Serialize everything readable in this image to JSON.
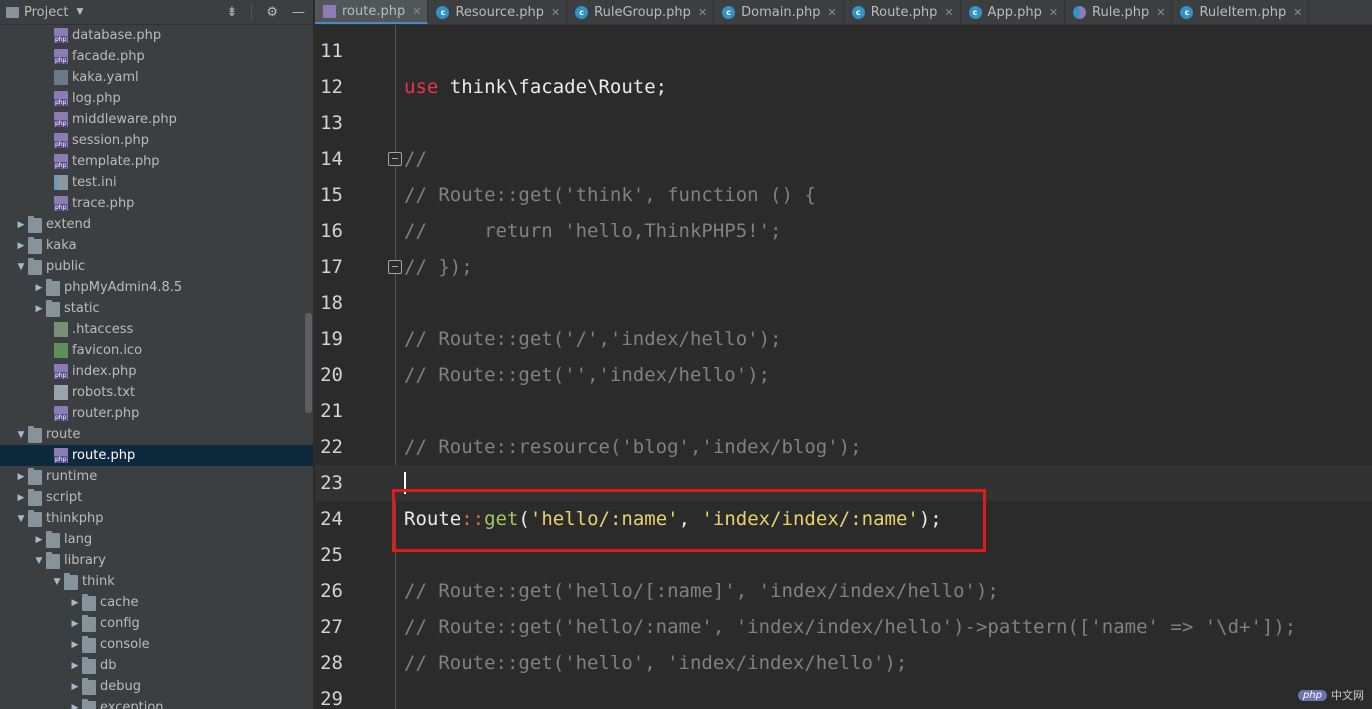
{
  "project_panel": {
    "title": "Project",
    "tree": [
      {
        "label": "database.php",
        "icon": "php-file-icon",
        "level": 3
      },
      {
        "label": "facade.php",
        "icon": "php-file-icon",
        "level": 3
      },
      {
        "label": "kaka.yaml",
        "icon": "yaml-file-icon",
        "level": 3
      },
      {
        "label": "log.php",
        "icon": "php-file-icon",
        "level": 3
      },
      {
        "label": "middleware.php",
        "icon": "php-file-icon",
        "level": 3
      },
      {
        "label": "session.php",
        "icon": "php-file-icon",
        "level": 3
      },
      {
        "label": "template.php",
        "icon": "php-file-icon",
        "level": 3
      },
      {
        "label": "test.ini",
        "icon": "ini-file-icon",
        "level": 3
      },
      {
        "label": "trace.php",
        "icon": "php-file-icon",
        "level": 3
      },
      {
        "label": "extend",
        "icon": "folder-icon",
        "level": 1,
        "expanded": false
      },
      {
        "label": "kaka",
        "icon": "folder-icon",
        "level": 1,
        "expanded": false
      },
      {
        "label": "public",
        "icon": "folder-icon",
        "level": 1,
        "expanded": true
      },
      {
        "label": "phpMyAdmin4.8.5",
        "icon": "folder-icon",
        "level": 2,
        "expanded": false
      },
      {
        "label": "static",
        "icon": "folder-icon",
        "level": 2,
        "expanded": false
      },
      {
        "label": ".htaccess",
        "icon": "htaccess-file-icon",
        "level": 3
      },
      {
        "label": "favicon.ico",
        "icon": "image-file-icon",
        "level": 3
      },
      {
        "label": "index.php",
        "icon": "php-file-icon",
        "level": 3
      },
      {
        "label": "robots.txt",
        "icon": "text-file-icon",
        "level": 3
      },
      {
        "label": "router.php",
        "icon": "php-file-icon",
        "level": 3
      },
      {
        "label": "route",
        "icon": "folder-icon",
        "level": 1,
        "expanded": true
      },
      {
        "label": "route.php",
        "icon": "php-file-icon",
        "level": 3,
        "selected": true
      },
      {
        "label": "runtime",
        "icon": "folder-icon",
        "level": 1,
        "expanded": false
      },
      {
        "label": "script",
        "icon": "folder-icon",
        "level": 1,
        "expanded": false
      },
      {
        "label": "thinkphp",
        "icon": "folder-icon",
        "level": 1,
        "expanded": true
      },
      {
        "label": "lang",
        "icon": "folder-icon",
        "level": 2,
        "expanded": false
      },
      {
        "label": "library",
        "icon": "folder-icon",
        "level": 2,
        "expanded": true
      },
      {
        "label": "think",
        "icon": "folder-icon",
        "level": 3,
        "expanded": true
      },
      {
        "label": "cache",
        "icon": "folder-icon",
        "level": 4,
        "expanded": false
      },
      {
        "label": "config",
        "icon": "folder-icon",
        "level": 4,
        "expanded": false
      },
      {
        "label": "console",
        "icon": "folder-icon",
        "level": 4,
        "expanded": false
      },
      {
        "label": "db",
        "icon": "folder-icon",
        "level": 4,
        "expanded": false
      },
      {
        "label": "debug",
        "icon": "folder-icon",
        "level": 4,
        "expanded": false
      },
      {
        "label": "exception",
        "icon": "folder-icon",
        "level": 4,
        "expanded": false
      }
    ]
  },
  "tabs": [
    {
      "label": "route.php",
      "icon": "php",
      "active": true
    },
    {
      "label": "Resource.php",
      "icon": "class"
    },
    {
      "label": "RuleGroup.php",
      "icon": "class"
    },
    {
      "label": "Domain.php",
      "icon": "class"
    },
    {
      "label": "Route.php",
      "icon": "class"
    },
    {
      "label": "App.php",
      "icon": "class"
    },
    {
      "label": "Rule.php",
      "icon": "half"
    },
    {
      "label": "RuleItem.php",
      "icon": "class"
    }
  ],
  "code": {
    "line_numbers": [
      "11",
      "12",
      "13",
      "14",
      "15",
      "16",
      "17",
      "18",
      "19",
      "20",
      "21",
      "22",
      "23",
      "24",
      "25",
      "26",
      "27",
      "28",
      "29"
    ],
    "current_line": "23",
    "lines": [
      {
        "n": "11",
        "parts": []
      },
      {
        "n": "12",
        "parts": [
          {
            "t": "use",
            "c": "kw-use"
          },
          {
            "t": " think\\facade\\Route;",
            "c": "plain"
          }
        ]
      },
      {
        "n": "13",
        "parts": []
      },
      {
        "n": "14",
        "parts": [
          {
            "t": "//",
            "c": "cmt"
          }
        ],
        "fold": true
      },
      {
        "n": "15",
        "parts": [
          {
            "t": "// Route::get('think', function () {",
            "c": "cmt"
          }
        ]
      },
      {
        "n": "16",
        "parts": [
          {
            "t": "//     return 'hello,ThinkPHP5!';",
            "c": "cmt"
          }
        ]
      },
      {
        "n": "17",
        "parts": [
          {
            "t": "// });",
            "c": "cmt"
          }
        ],
        "fold": true
      },
      {
        "n": "18",
        "parts": []
      },
      {
        "n": "19",
        "parts": [
          {
            "t": "// Route::get('/','index/hello');",
            "c": "cmt"
          }
        ]
      },
      {
        "n": "20",
        "parts": [
          {
            "t": "// Route::get('','index/hello');",
            "c": "cmt"
          }
        ]
      },
      {
        "n": "21",
        "parts": []
      },
      {
        "n": "22",
        "parts": [
          {
            "t": "// Route::resource('blog','index/blog');",
            "c": "cmt"
          }
        ]
      },
      {
        "n": "23",
        "parts": [],
        "caret": true
      },
      {
        "n": "24",
        "parts": [
          {
            "t": "Route",
            "c": "plain"
          },
          {
            "t": "::",
            "c": "op"
          },
          {
            "t": "get",
            "c": "fn"
          },
          {
            "t": "(",
            "c": "plain"
          },
          {
            "t": "'hello/:name'",
            "c": "str"
          },
          {
            "t": ", ",
            "c": "plain"
          },
          {
            "t": "'index/index/:name'",
            "c": "str"
          },
          {
            "t": ");",
            "c": "plain"
          }
        ]
      },
      {
        "n": "25",
        "parts": []
      },
      {
        "n": "26",
        "parts": [
          {
            "t": "// Route::get('hello/[:name]', 'index/index/hello');",
            "c": "cmt"
          }
        ]
      },
      {
        "n": "27",
        "parts": [
          {
            "t": "// Route::get('hello/:name', 'index/index/hello')->pattern(['name' => '\\d+']);",
            "c": "cmt"
          }
        ]
      },
      {
        "n": "28",
        "parts": [
          {
            "t": "// Route::get('hello', 'index/index/hello');",
            "c": "cmt"
          }
        ]
      },
      {
        "n": "29",
        "parts": []
      }
    ]
  },
  "watermark": {
    "badge": "php",
    "text": "中文网"
  },
  "colors": {
    "highlight_box": "#e01b1b",
    "selection": "#0d293e",
    "active_tab_underline": "#4a88c7"
  }
}
